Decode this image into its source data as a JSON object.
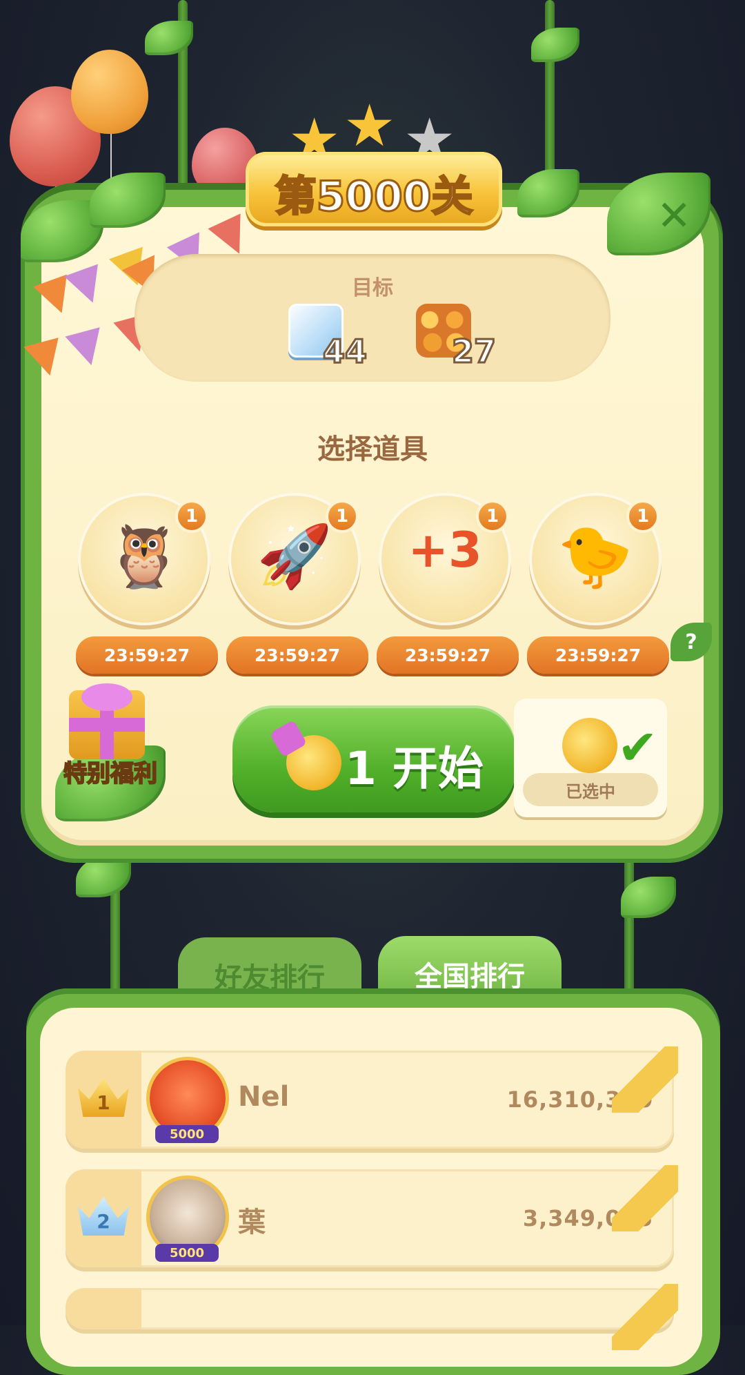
{
  "level": {
    "title": "第5000关",
    "stars_earned": 2,
    "stars_total": 3
  },
  "goals": {
    "label": "目标",
    "items": [
      {
        "icon": "ice-block-icon",
        "count": "44"
      },
      {
        "icon": "gold-coins-icon",
        "count": "27"
      }
    ]
  },
  "boosters": {
    "title": "选择道具",
    "items": [
      {
        "icon": "rainbow-owl-icon",
        "count": "1",
        "timer": "23:59:27"
      },
      {
        "icon": "firework-rockets-icon",
        "count": "1",
        "timer": "23:59:27"
      },
      {
        "icon": "plus-three-moves-icon",
        "count": "1",
        "timer": "23:59:27"
      },
      {
        "icon": "hippo-chick-swap-icon",
        "count": "1",
        "timer": "23:59:27"
      }
    ],
    "help_label": "?"
  },
  "start": {
    "count": "1",
    "label": "开始"
  },
  "selected": {
    "label": "已选中"
  },
  "special": {
    "label": "特别福利"
  },
  "leaderboard": {
    "tabs": [
      {
        "label": "好友排行",
        "active": false
      },
      {
        "label": "全国排行",
        "active": true
      }
    ],
    "rows": [
      {
        "rank": "1",
        "name": "Nel",
        "score": "16,310,370",
        "badge": "5000"
      },
      {
        "rank": "2",
        "name": "葉",
        "score": "3,349,085",
        "badge": "5000"
      }
    ]
  },
  "colors": {
    "panel_green": "#6fb342",
    "cream": "#fff7d6",
    "orange": "#e27a20",
    "gold": "#f7c43a"
  }
}
